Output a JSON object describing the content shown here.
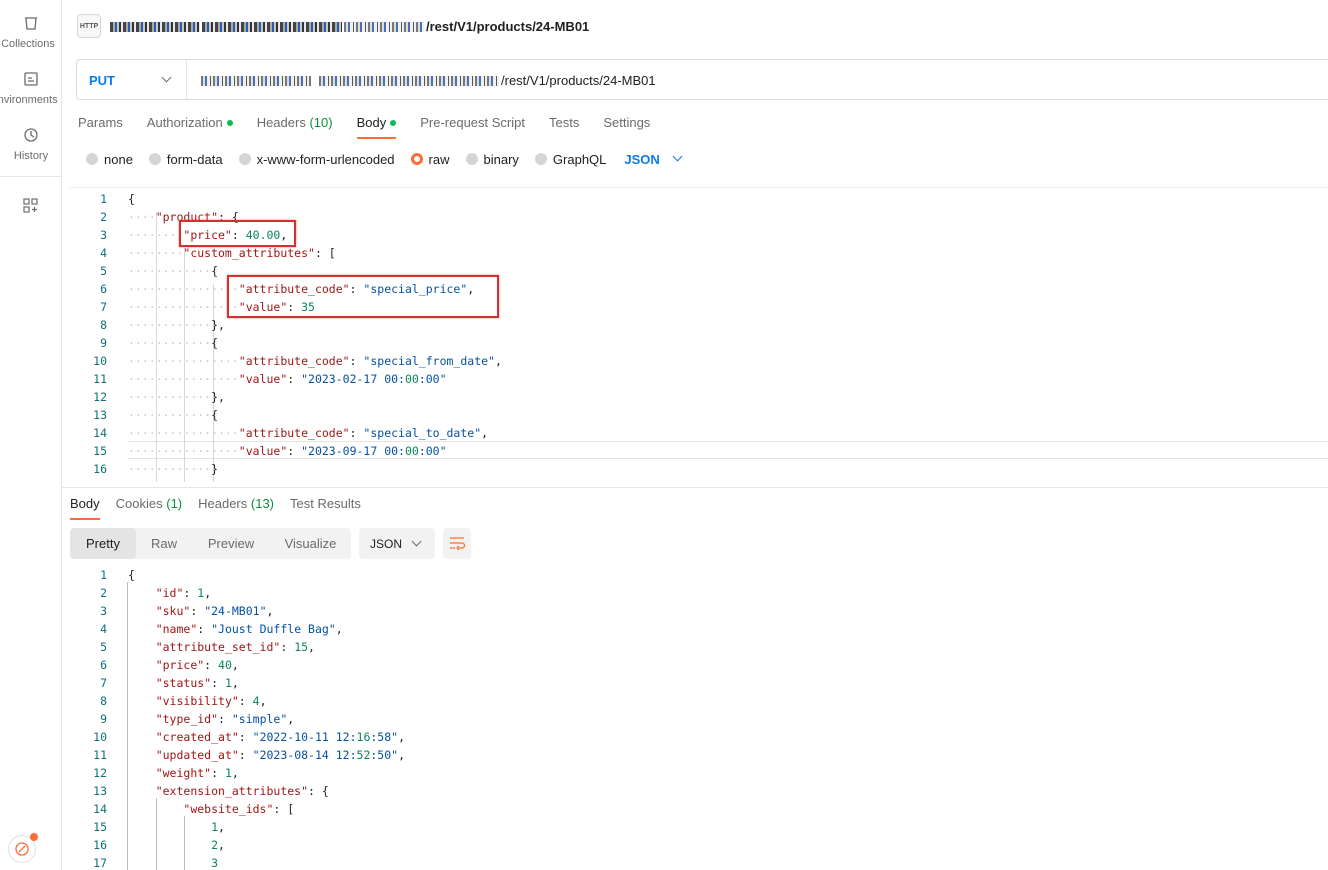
{
  "sidebar": {
    "items": [
      {
        "label": "Collections",
        "icon": "collections-icon"
      },
      {
        "label": "Environments",
        "icon": "environments-icon"
      },
      {
        "label": "History",
        "icon": "history-icon"
      },
      {
        "label": "",
        "icon": "add-workspace-icon"
      }
    ]
  },
  "header": {
    "badge": "HTTP",
    "title_path": "/rest/V1/products/24-MB01"
  },
  "request": {
    "method": "PUT",
    "url_path": "/rest/V1/products/24-MB01",
    "tabs": [
      {
        "label": "Params"
      },
      {
        "label": "Authorization",
        "dot": true
      },
      {
        "label": "Headers",
        "count": "(10)"
      },
      {
        "label": "Body",
        "dot": true,
        "active": true
      },
      {
        "label": "Pre-request Script"
      },
      {
        "label": "Tests"
      },
      {
        "label": "Settings"
      }
    ],
    "body_types": [
      "none",
      "form-data",
      "x-www-form-urlencoded",
      "raw",
      "binary",
      "GraphQL"
    ],
    "body_type_selected": "raw",
    "language": "JSON"
  },
  "request_body_lines": [
    "{",
    "    \"product\": {",
    "        \"price\": 40.00,",
    "        \"custom_attributes\": [",
    "            {",
    "                \"attribute_code\": \"special_price\",",
    "                \"value\": 35",
    "            },",
    "            {",
    "                \"attribute_code\": \"special_from_date\",",
    "                \"value\": \"2023-02-17 00:00:00\"",
    "            },",
    "            {",
    "                \"attribute_code\": \"special_to_date\",",
    "                \"value\": \"2023-09-17 00:00:00\"",
    "            }"
  ],
  "response": {
    "tabs": [
      {
        "label": "Body",
        "active": true
      },
      {
        "label": "Cookies",
        "count": "(1)"
      },
      {
        "label": "Headers",
        "count": "(13)"
      },
      {
        "label": "Test Results"
      }
    ],
    "views": [
      "Pretty",
      "Raw",
      "Preview",
      "Visualize"
    ],
    "view_selected": "Pretty",
    "format": "JSON",
    "lines": [
      "{",
      "    \"id\": 1,",
      "    \"sku\": \"24-MB01\",",
      "    \"name\": \"Joust Duffle Bag\",",
      "    \"attribute_set_id\": 15,",
      "    \"price\": 40,",
      "    \"status\": 1,",
      "    \"visibility\": 4,",
      "    \"type_id\": \"simple\",",
      "    \"created_at\": \"2022-10-11 12:16:58\",",
      "    \"updated_at\": \"2023-08-14 12:52:50\",",
      "    \"weight\": 1,",
      "    \"extension_attributes\": {",
      "        \"website_ids\": [",
      "            1,",
      "            2,",
      "            3"
    ]
  }
}
